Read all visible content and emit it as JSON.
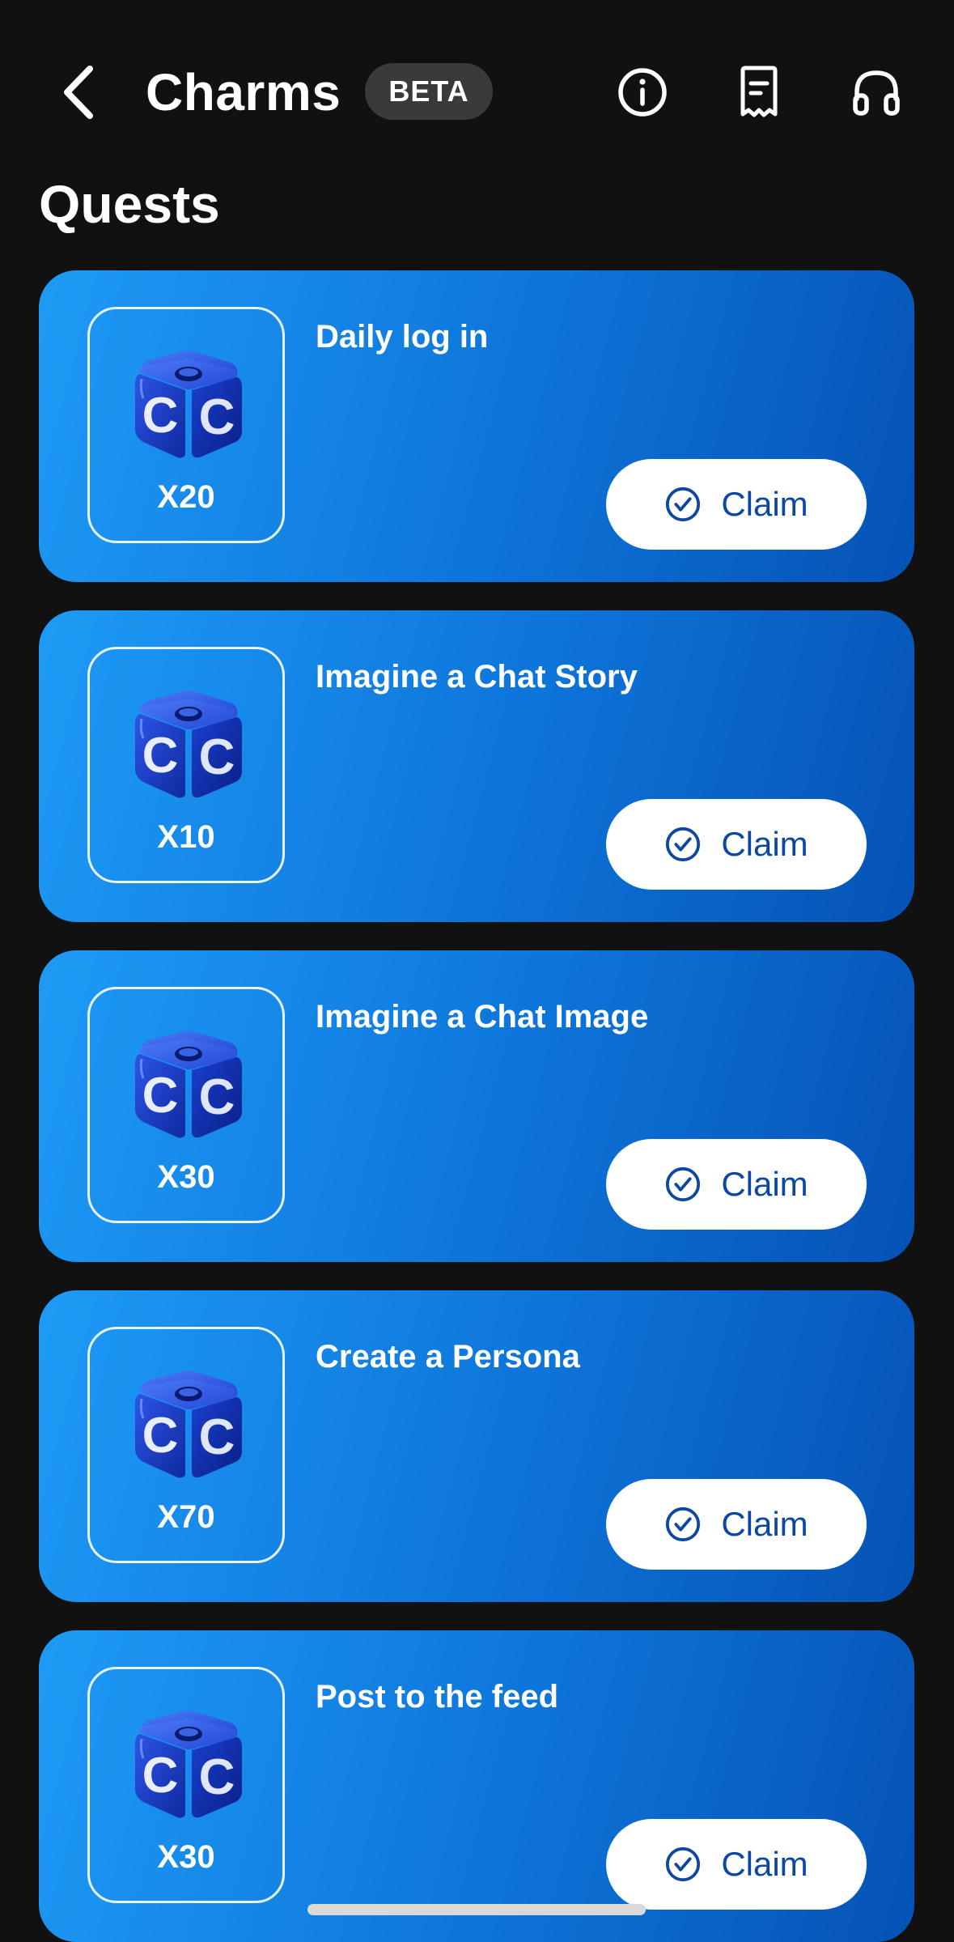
{
  "header": {
    "title": "Charms",
    "badge": "BETA",
    "icons": [
      "back-chevron-icon",
      "info-icon",
      "receipt-icon",
      "headphones-icon"
    ]
  },
  "section": {
    "title": "Quests"
  },
  "quests": [
    {
      "name": "Daily log in",
      "reward": "X20",
      "action": "Claim"
    },
    {
      "name": "Imagine a Chat Story",
      "reward": "X10",
      "action": "Claim"
    },
    {
      "name": "Imagine a Chat Image",
      "reward": "X30",
      "action": "Claim"
    },
    {
      "name": "Create a Persona",
      "reward": "X70",
      "action": "Claim"
    },
    {
      "name": "Post to the feed",
      "reward": "X30",
      "action": "Claim"
    }
  ],
  "colors": {
    "background": "#111111",
    "card_gradient_start": "#1e9bf6",
    "card_gradient_end": "#0652b5",
    "claim_text": "#0b47a3",
    "badge_bg": "#3a3a3a"
  }
}
